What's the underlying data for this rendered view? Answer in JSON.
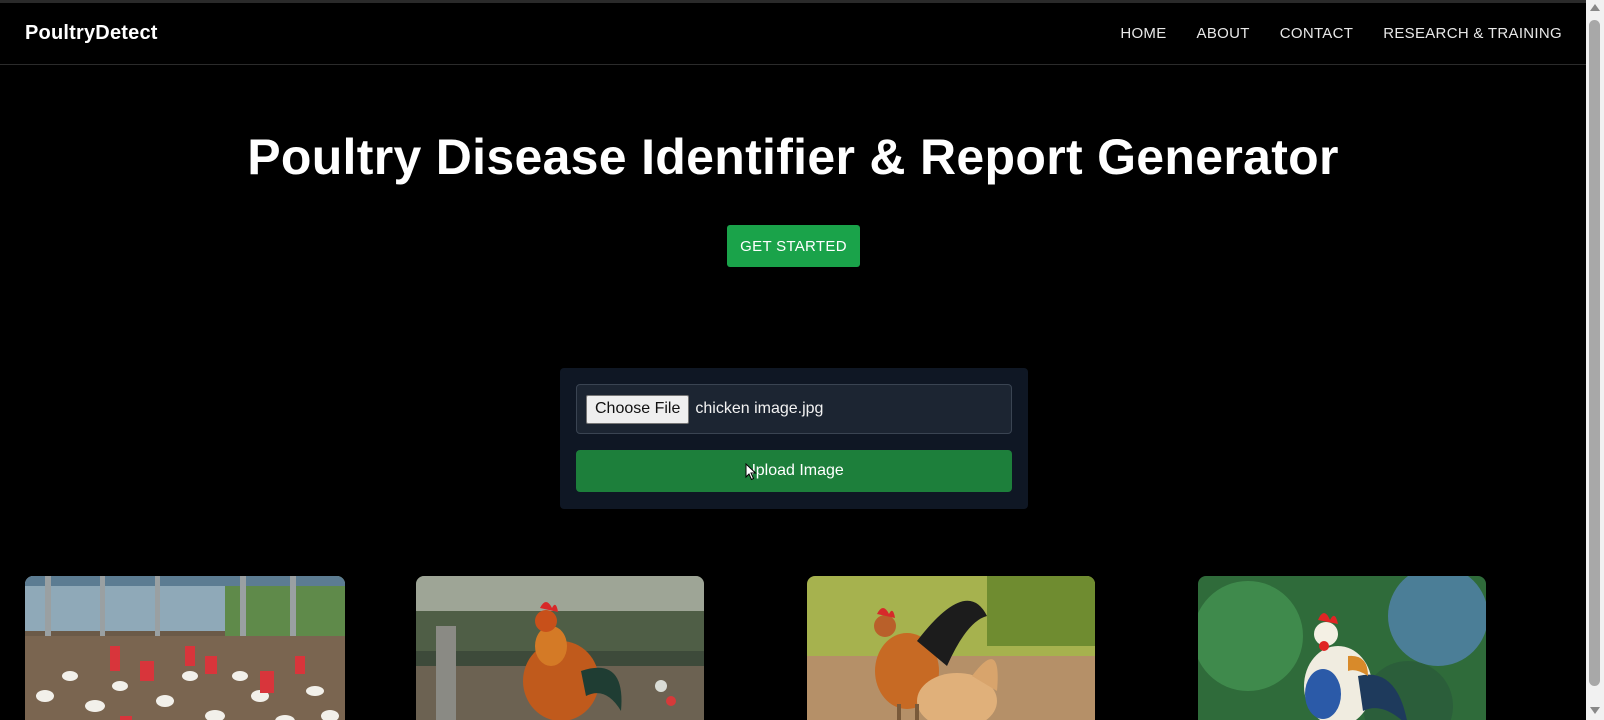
{
  "navbar": {
    "brand": "PoultryDetect",
    "links": [
      "HOME",
      "ABOUT",
      "CONTACT",
      "RESEARCH & TRAINING"
    ]
  },
  "hero": {
    "title": "Poultry Disease Identifier & Report Generator",
    "cta_label": "GET STARTED"
  },
  "upload": {
    "choose_label": "Choose File",
    "file_name": "chicken image.jpg",
    "button_label": "Upload Image"
  },
  "gallery": {
    "images": [
      "poultry-farm-photo",
      "rooster-photo",
      "rooster-and-hen-photo",
      "colorful-rooster-photo"
    ]
  },
  "colors": {
    "background": "#000000",
    "cta_green": "#1aa34a",
    "upload_green": "#1d7f3b",
    "card_bg": "#0f1724"
  }
}
